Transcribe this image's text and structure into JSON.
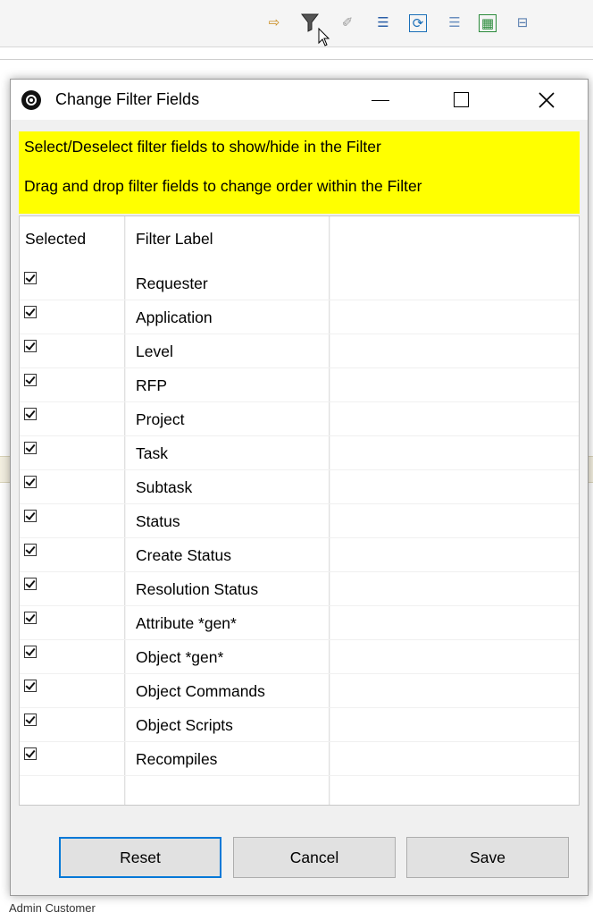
{
  "background": {
    "toolbar_icons": [
      {
        "name": "import-icon",
        "glyph": "⇨"
      },
      {
        "name": "filter-icon",
        "glyph": ""
      },
      {
        "name": "eraser-icon",
        "glyph": "⌫"
      },
      {
        "name": "numbered-list-icon",
        "glyph": "☰"
      },
      {
        "name": "refresh-grid-icon",
        "glyph": "⟳"
      },
      {
        "name": "bulleted-list-icon",
        "glyph": "☰"
      },
      {
        "name": "excel-export-icon",
        "glyph": "▦"
      },
      {
        "name": "collapse-icon",
        "glyph": "⊟"
      }
    ],
    "bottom_text": "Admin Customer"
  },
  "dialog": {
    "title": "Change Filter Fields",
    "banner": {
      "line1": "Select/Deselect filter fields to show/hide in the Filter",
      "line2": "Drag and drop filter fields to change order within the Filter",
      "color": "#ffff00"
    },
    "table": {
      "columns": [
        "Selected",
        "Filter Label"
      ],
      "rows": [
        {
          "selected": true,
          "label": "Requester"
        },
        {
          "selected": true,
          "label": "Application"
        },
        {
          "selected": true,
          "label": "Level"
        },
        {
          "selected": true,
          "label": "RFP"
        },
        {
          "selected": true,
          "label": "Project"
        },
        {
          "selected": true,
          "label": "Task"
        },
        {
          "selected": true,
          "label": "Subtask"
        },
        {
          "selected": true,
          "label": "Status"
        },
        {
          "selected": true,
          "label": "Create Status"
        },
        {
          "selected": true,
          "label": "Resolution Status"
        },
        {
          "selected": true,
          "label": "Attribute *gen*"
        },
        {
          "selected": true,
          "label": "Object *gen*"
        },
        {
          "selected": true,
          "label": "Object Commands"
        },
        {
          "selected": true,
          "label": "Object Scripts"
        },
        {
          "selected": true,
          "label": "Recompiles"
        }
      ]
    },
    "buttons": {
      "reset": "Reset",
      "cancel": "Cancel",
      "save": "Save"
    },
    "accent_color": "#0078d7"
  }
}
